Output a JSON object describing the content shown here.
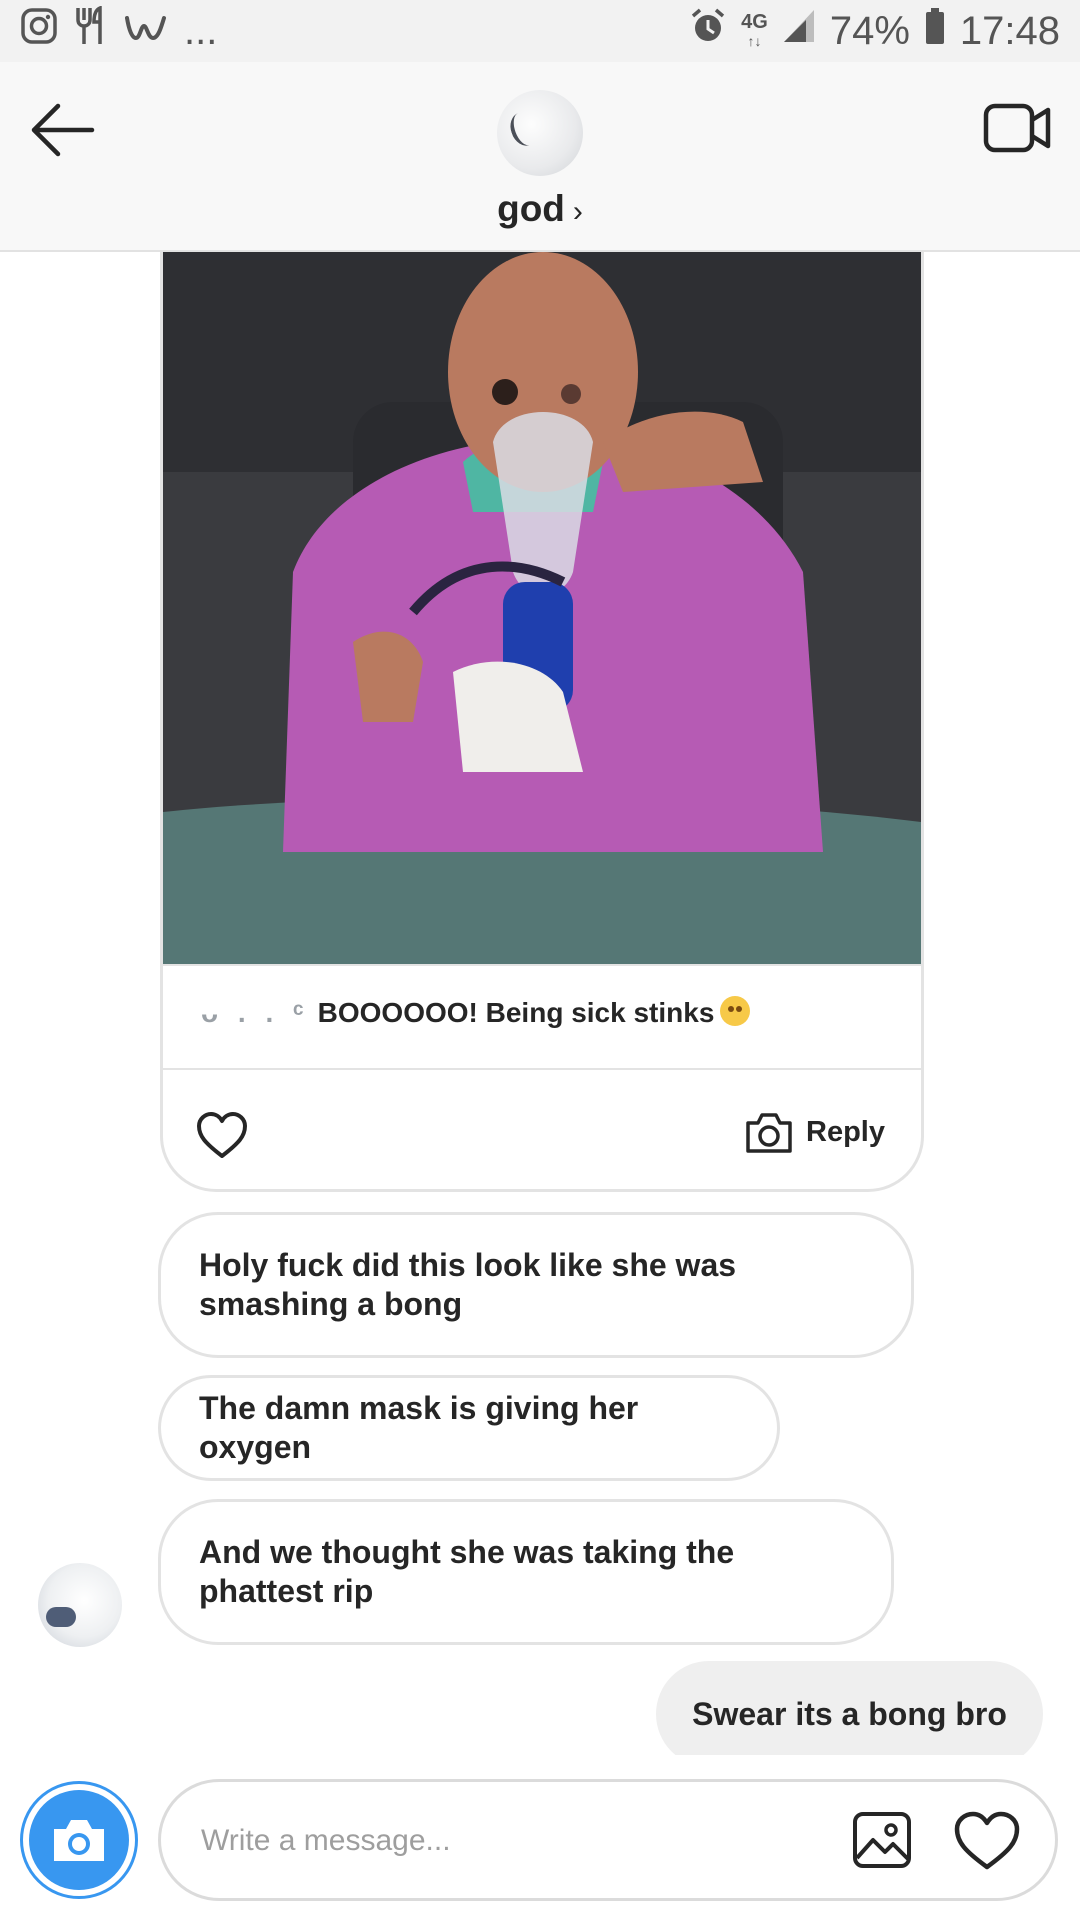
{
  "status_bar": {
    "icons_left": [
      "instagram-icon",
      "restaurant-icon",
      "w-app-icon"
    ],
    "more": "...",
    "icons_right": [
      "alarm-icon",
      "network-4g-icon",
      "signal-icon",
      "battery-icon"
    ],
    "network": "4G",
    "battery": "74%",
    "time": "17:48"
  },
  "header": {
    "title": "god",
    "chevron": "›",
    "icons": [
      "back-arrow-icon",
      "video-call-icon"
    ]
  },
  "shared_post": {
    "caption_user": "ᴗ . .  ᶜ",
    "caption_text": "BOOOOOO! Being sick stinks",
    "emoji_name": "flushed-face-emoji",
    "reply_label": "Reply"
  },
  "messages": [
    {
      "text": "Holy fuck did this look like she was smashing a bong"
    },
    {
      "text": "The damn mask is giving her oxygen"
    },
    {
      "text": "And we thought she was taking the phattest rip"
    }
  ],
  "sent_message": {
    "text": "Swear its a bong bro"
  },
  "composer": {
    "placeholder": "Write a message...",
    "icons": [
      "camera-icon",
      "gallery-icon",
      "heart-icon"
    ]
  },
  "colors": {
    "accent": "#3897f0",
    "text": "#262626",
    "border": "#e3e3e3",
    "sent_bubble": "#efefef"
  }
}
